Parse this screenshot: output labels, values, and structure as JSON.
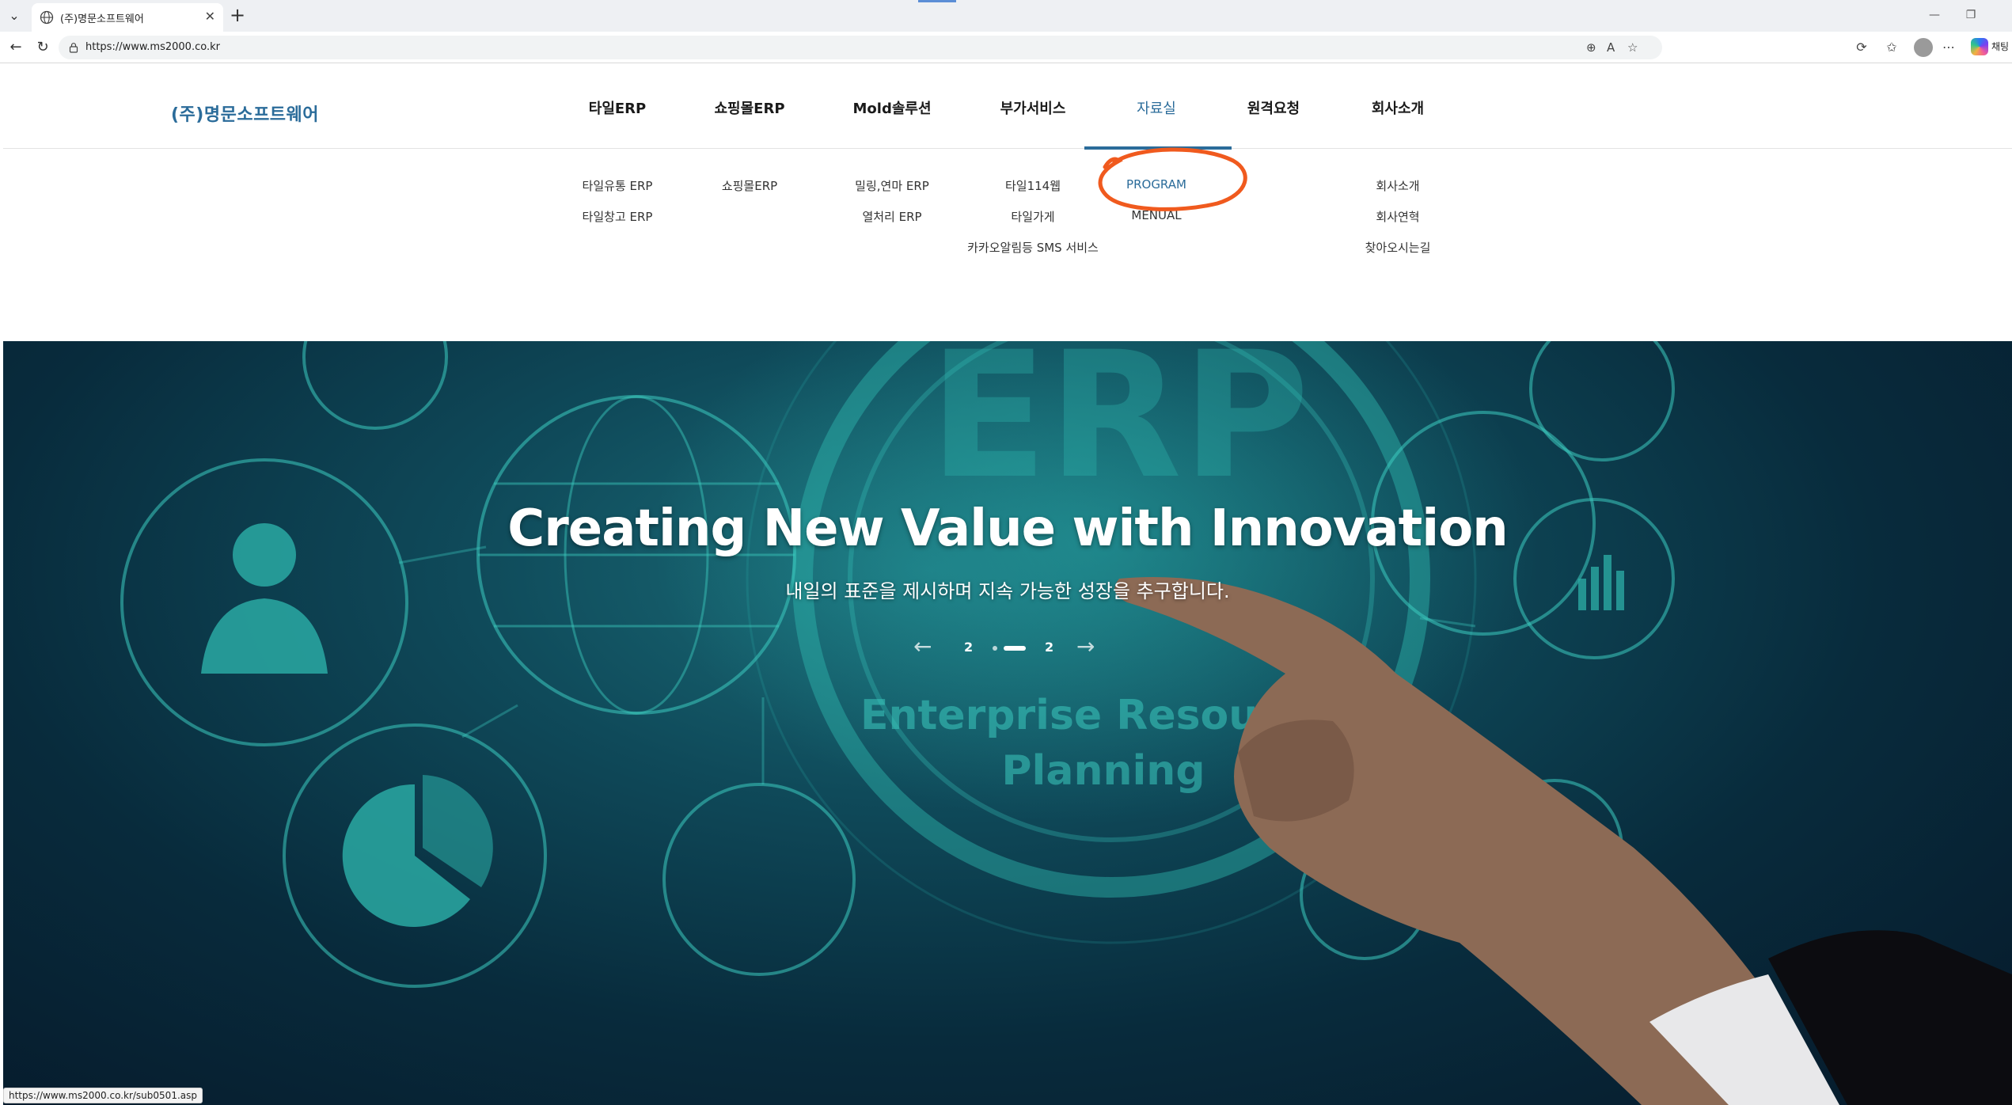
{
  "browser": {
    "tab_title": "(주)명문소프트웨어",
    "url": "https://www.ms2000.co.kr",
    "status_url": "https://www.ms2000.co.kr/sub0501.asp",
    "copilot_label": "채팅"
  },
  "site": {
    "logo": "(주)명문소프트웨어",
    "nav": [
      "타일ERP",
      "쇼핑몰ERP",
      "Mold솔루션",
      "부가서비스",
      "자료실",
      "원격요청",
      "회사소개"
    ],
    "active_nav": "자료실",
    "submenu": {
      "tile_erp": [
        "타일유통 ERP",
        "타일창고 ERP"
      ],
      "shop_erp": [
        "쇼핑몰ERP"
      ],
      "mold": [
        "밀링,연마 ERP",
        "열처리 ERP"
      ],
      "extra": [
        "타일114웹",
        "타일가게",
        "카카오알림등 SMS 서비스"
      ],
      "library": [
        "PROGRAM",
        "MENUAL"
      ],
      "company": [
        "회사소개",
        "회사연혁",
        "찾아오시는길"
      ]
    },
    "accent_color": "#2b6c9a",
    "annotation_color": "#f05a1e"
  },
  "hero": {
    "title": "Creating New Value with Innovation",
    "subtitle": "내일의 표준을 제시하며 지속 가능한 성장을 추구합니다.",
    "pager_current": "2",
    "pager_total": "2",
    "bg_text_erp": "ERP",
    "bg_text_line1": "Enterprise Resource",
    "bg_text_line2": "Planning"
  }
}
